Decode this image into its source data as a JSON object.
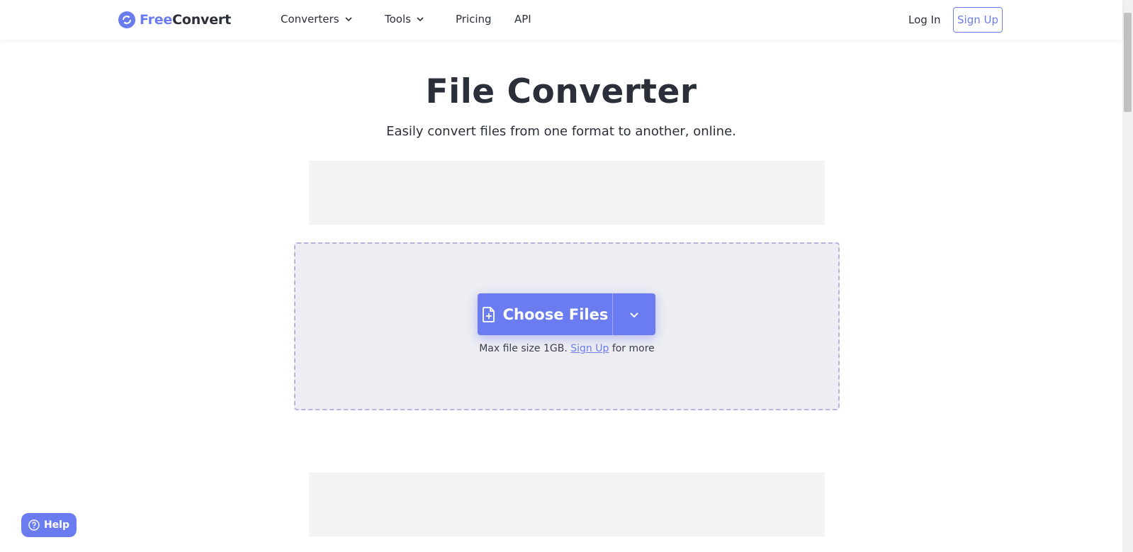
{
  "brand": {
    "part1": "Free",
    "part2": "Convert",
    "accent": "#6b7cf0"
  },
  "nav": {
    "converters": "Converters",
    "tools": "Tools",
    "pricing": "Pricing",
    "api": "API"
  },
  "auth": {
    "login": "Log In",
    "signup": "Sign Up"
  },
  "hero": {
    "title": "File Converter",
    "subtitle": "Easily convert files from one format to another, online."
  },
  "upload": {
    "button_label": "Choose Files",
    "max_text": "Max file size 1GB.",
    "signup_link": "Sign Up",
    "more_text": "for more"
  },
  "help": {
    "label": "Help"
  },
  "icons": [
    "logo-sync-icon",
    "chevron-down-icon",
    "file-add-icon",
    "help-circle-icon"
  ]
}
